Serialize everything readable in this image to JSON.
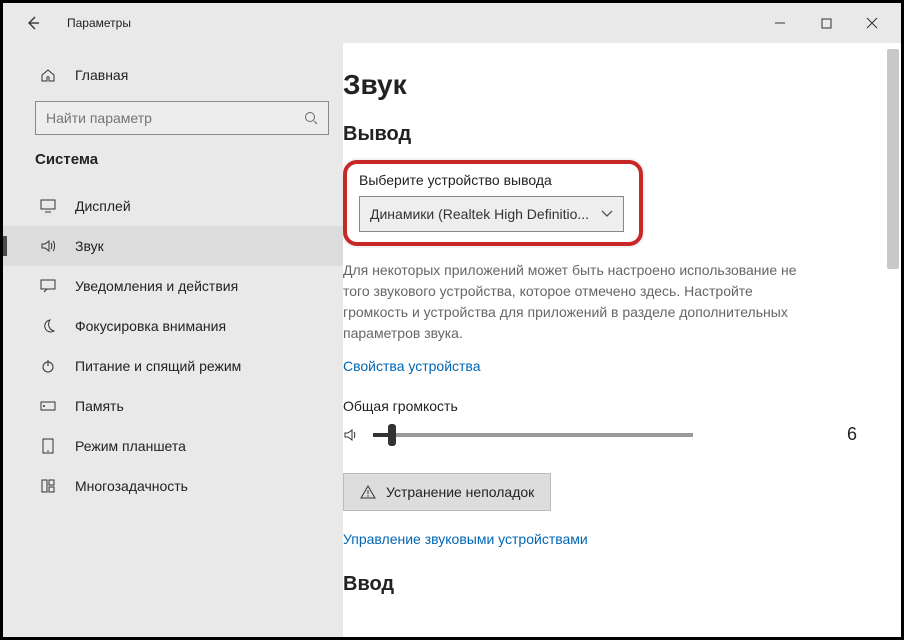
{
  "window": {
    "title": "Параметры"
  },
  "sidebar": {
    "home": "Главная",
    "search_placeholder": "Найти параметр",
    "section": "Система",
    "items": [
      {
        "label": "Дисплей"
      },
      {
        "label": "Звук"
      },
      {
        "label": "Уведомления и действия"
      },
      {
        "label": "Фокусировка внимания"
      },
      {
        "label": "Питание и спящий режим"
      },
      {
        "label": "Память"
      },
      {
        "label": "Режим планшета"
      },
      {
        "label": "Многозадачность"
      }
    ]
  },
  "main": {
    "page_title": "Звук",
    "output_heading": "Вывод",
    "select_label": "Выберите устройство вывода",
    "selected_device": "Динамики (Realtek High Definitio...",
    "note": "Для некоторых приложений может быть настроено использование не того звукового устройства, которое отмечено здесь. Настройте громкость и устройства для приложений в разделе дополнительных параметров звука.",
    "device_props": "Свойства устройства",
    "volume_label": "Общая громкость",
    "volume_value": "6",
    "troubleshoot": "Устранение неполадок",
    "manage_link": "Управление звуковыми устройствами",
    "input_heading": "Ввод"
  }
}
